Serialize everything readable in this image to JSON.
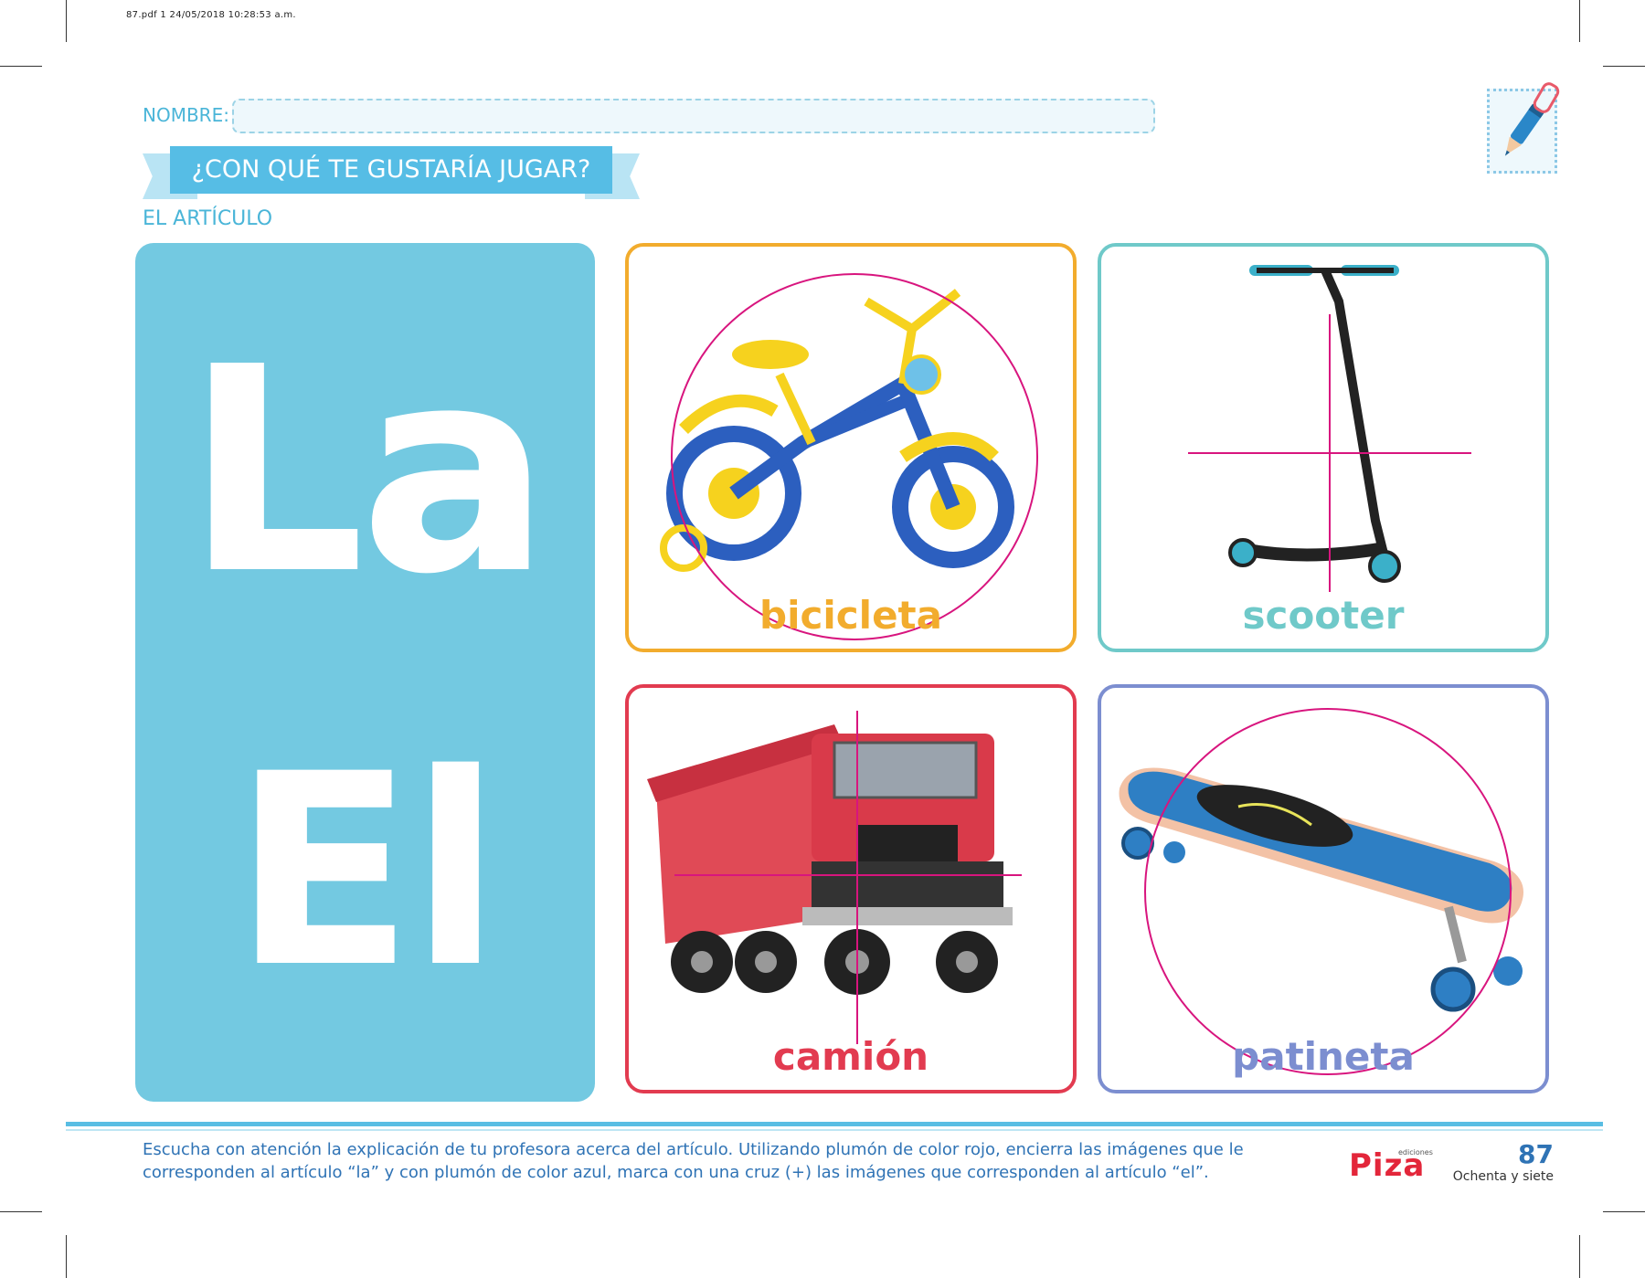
{
  "print_info": "87.pdf   1   24/05/2018   10:28:53 a.m.",
  "header": {
    "name_label": "NOMBRE:",
    "title": "¿CON QUÉ TE GUSTARÍA JUGAR?",
    "subtitle": "EL ARTÍCULO"
  },
  "articles": {
    "la": "La",
    "el": "El"
  },
  "cards": [
    {
      "label": "bicicleta",
      "color": "#f2ac2d",
      "mark": "circle"
    },
    {
      "label": "scooter",
      "color": "#6fc9c9",
      "mark": "cross"
    },
    {
      "label": "camión",
      "color": "#e23b50",
      "mark": "cross"
    },
    {
      "label": "patineta",
      "color": "#7c8ed0",
      "mark": "circle"
    }
  ],
  "mark_color": "#d8157e",
  "footer": {
    "instructions": "Escucha con atención la explicación de tu profesora acerca del artículo. Utilizando plumón de color rojo, encierra las imágenes que le corresponden al artículo “la” y con plumón de color azul, marca con una cruz (+) las imágenes que corresponden al artículo “el”.",
    "publisher_small": "ediciones",
    "publisher": "Piza",
    "page_number": "87",
    "page_words": "Ochenta y siete"
  }
}
